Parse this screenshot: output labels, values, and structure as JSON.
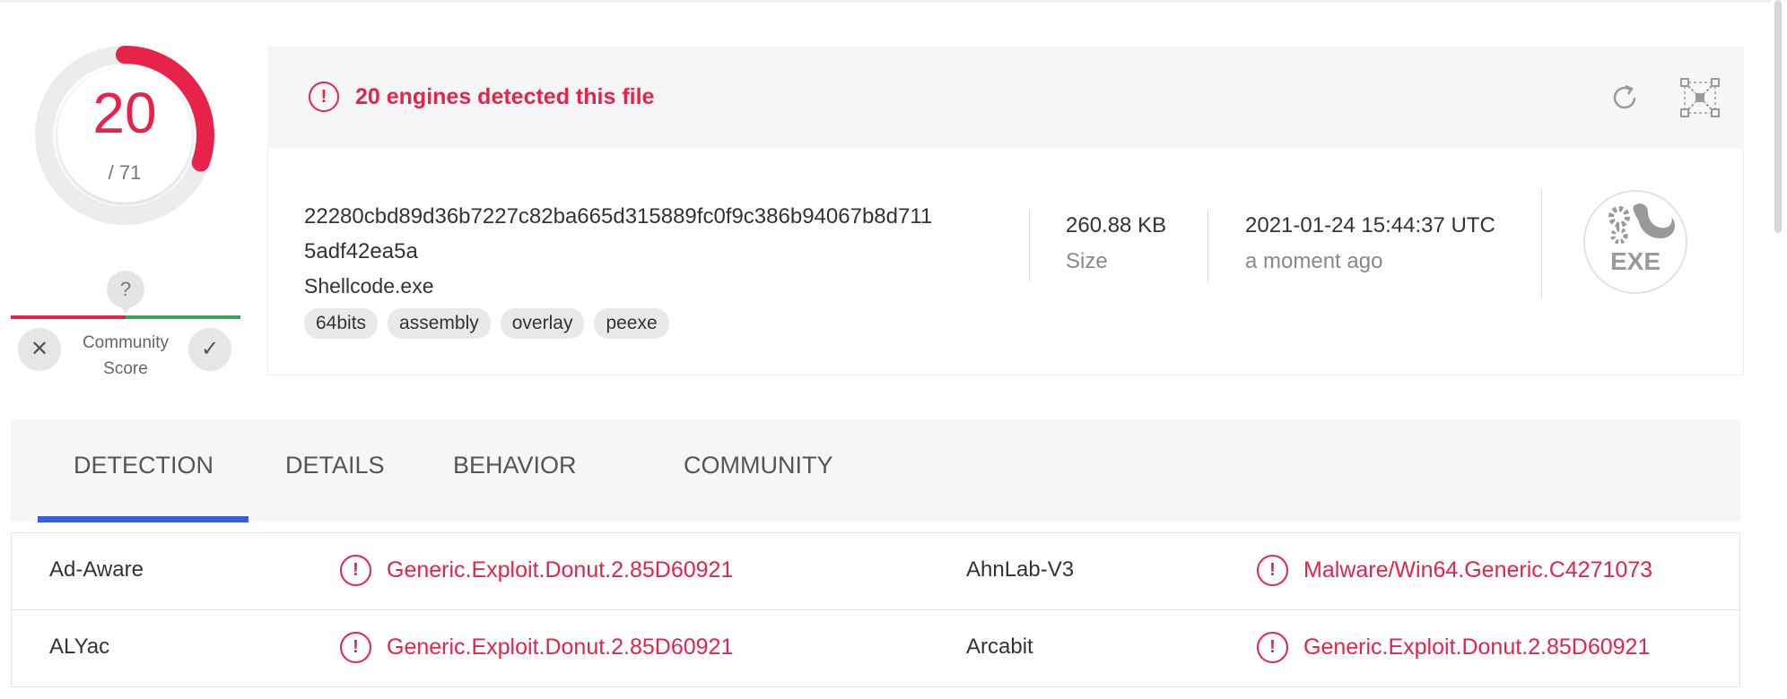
{
  "score": {
    "detected": "20",
    "total": "/ 71",
    "color_ring": "#e8234a"
  },
  "community": {
    "bubble": "?",
    "label_line1": "Community",
    "label_line2": "Score"
  },
  "alert": {
    "text": "20 engines detected this file"
  },
  "file": {
    "hash_line1": "22280cbd89d36b7227c82ba665d315889fc0f9c386b94067b8d711",
    "hash_line2": "5adf42ea5a",
    "name": "Shellcode.exe",
    "tags": [
      "64bits",
      "assembly",
      "overlay",
      "peexe"
    ],
    "size_value": "260.88 KB",
    "size_label": "Size",
    "date_value": "2021-01-24 15:44:37 UTC",
    "date_relative": "a moment ago",
    "type_icon_label": "EXE"
  },
  "tabs": [
    {
      "label": "DETECTION",
      "active": true
    },
    {
      "label": "DETAILS",
      "active": false
    },
    {
      "label": "BEHAVIOR",
      "active": false
    },
    {
      "label": "COMMUNITY",
      "active": false
    }
  ],
  "detections": [
    {
      "engine_left": "Ad-Aware",
      "result_left": "Generic.Exploit.Donut.2.85D60921",
      "engine_right": "AhnLab-V3",
      "result_right": "Malware/Win64.Generic.C4271073"
    },
    {
      "engine_left": "ALYac",
      "result_left": "Generic.Exploit.Donut.2.85D60921",
      "engine_right": "Arcabit",
      "result_right": "Generic.Exploit.Donut.2.85D60921"
    }
  ],
  "colors": {
    "malicious": "#e8234a",
    "harmless": "#3aa55a",
    "tab_active": "#3b5bdb"
  }
}
